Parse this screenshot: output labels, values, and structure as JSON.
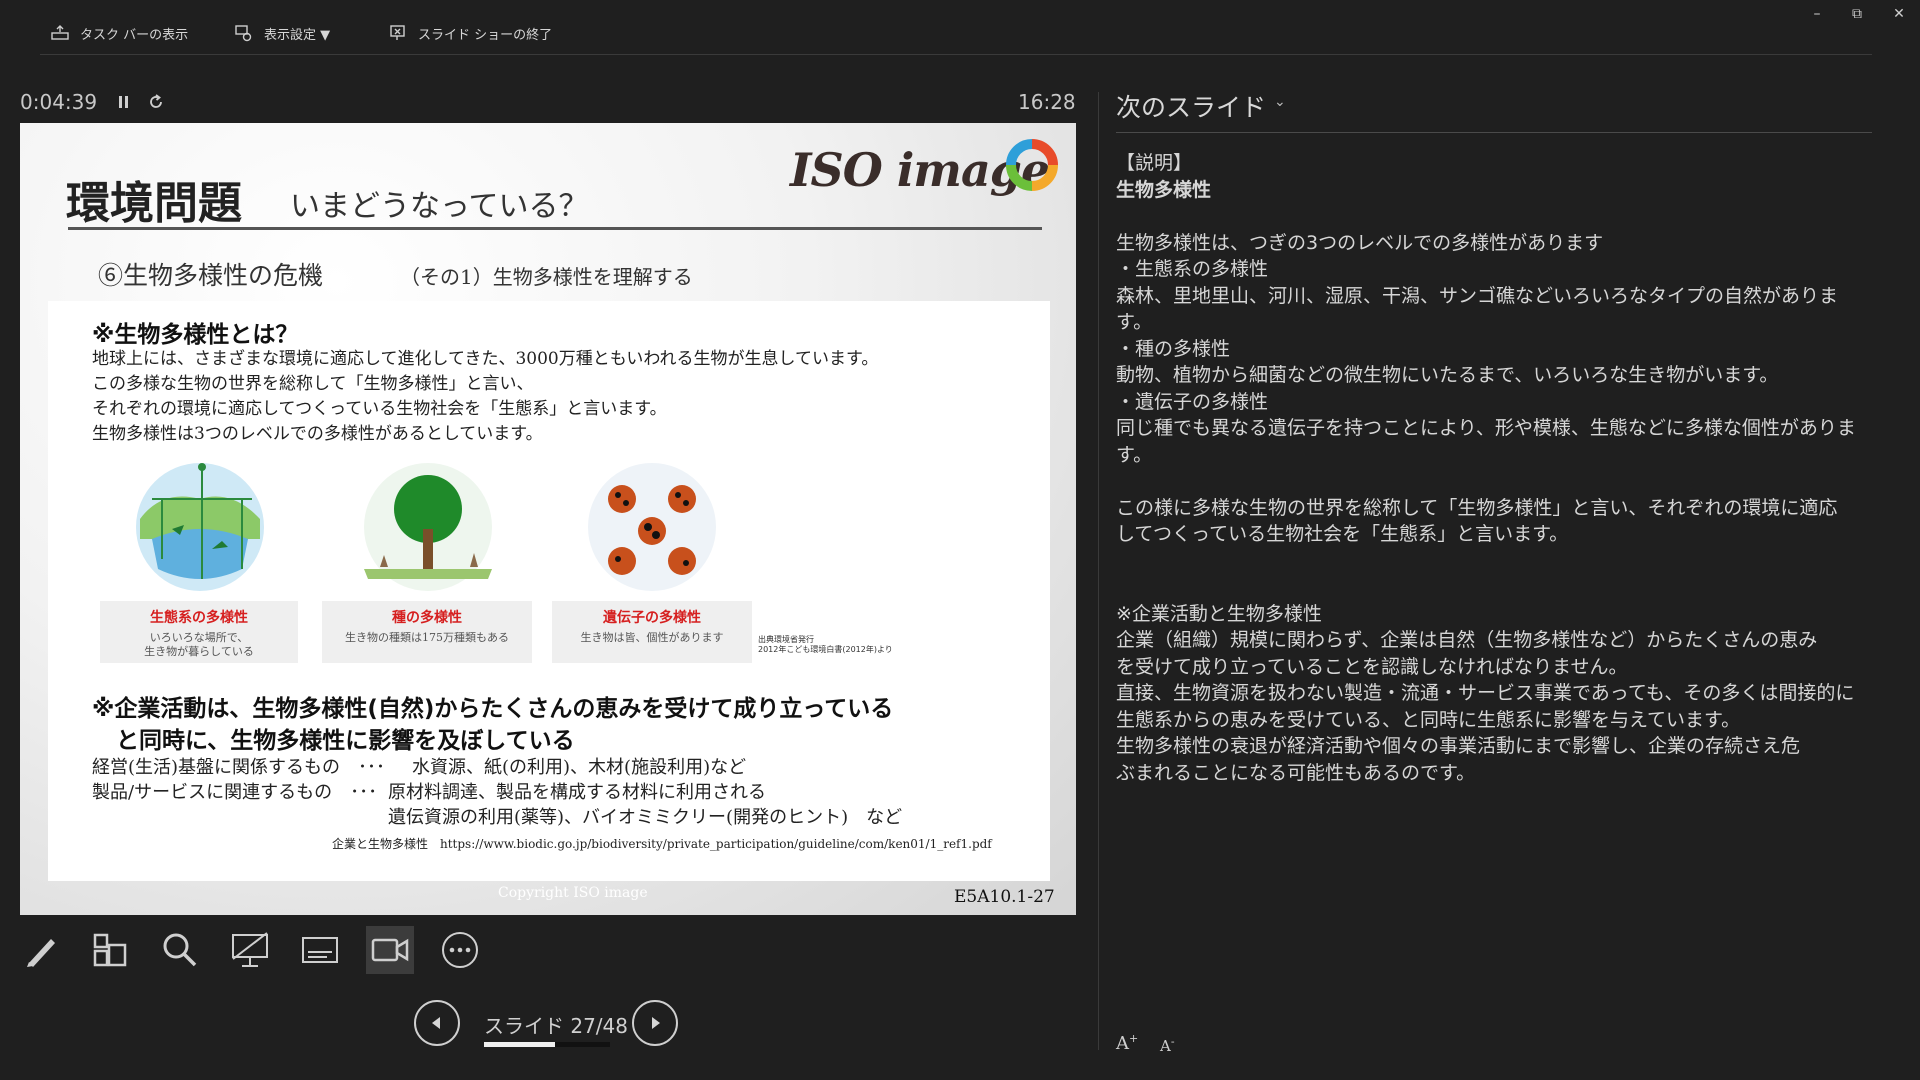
{
  "toolbar": {
    "taskbar_label": "タスク バーの表示",
    "display_settings_label": "表示設定 ▼",
    "end_show_label": "スライド ショーの終了"
  },
  "window": {
    "minimize": "–",
    "restore": "⧉",
    "close": "✕"
  },
  "presenter": {
    "elapsed": "0:04:39",
    "clock": "16:28",
    "slide_counter": "スライド 27/48",
    "progress_fraction": 0.5625
  },
  "slide": {
    "title": "環境問題",
    "subtitle": "いまどうなっている？",
    "section": "⑥生物多様性の危機",
    "section_sub": "（その1）生物多様性を理解する",
    "logo_text": "ISO image",
    "heading1": "※生物多様性とは？",
    "body": [
      "地球上には、さまざまな環境に適応して進化してきた、3000万種ともいわれる生物が生息しています。",
      "この多様な生物の世界を総称して「生物多様性」と言い、",
      "それぞれの環境に適応してつくっている生物社会を「生態系」と言います。",
      "生物多様性は3つのレベルでの多様性があるとしています。"
    ],
    "captions": [
      {
        "title": "生態系の多様性",
        "text1": "いろいろな場所で、",
        "text2": "生き物が暮らしている"
      },
      {
        "title": "種の多様性",
        "text1": "生き物の種類は175万種類もある",
        "text2": ""
      },
      {
        "title": "遺伝子の多様性",
        "text1": "生き物は皆、個性があります",
        "text2": ""
      }
    ],
    "source_note_1": "出典環境省発行",
    "source_note_2": "2012年こども環境白書(2012年)より",
    "heading2_line1": "※企業活動は、生物多様性(自然)からたくさんの恵みを受けて成り立っている",
    "heading2_line2": "と同時に、生物多様性に影響を及ぼしている",
    "list": [
      {
        "key": "経営(生活)基盤に関係するもの　･･･",
        "value": "水資源、紙(の利用)、木材(施設利用)など"
      },
      {
        "key": "製品/サービスに関連するもの　･･･",
        "value": "原材料調達、製品を構成する材料に利用される"
      },
      {
        "key": "",
        "value": "遺伝資源の利用(薬等)、バイオミミクリー(開発のヒント)　など"
      }
    ],
    "url_line": "企業と生物多様性　https://www.biodic.go.jp/biodiversity/private_participation/guideline/com/ken01/1_ref1.pdf",
    "copyright": "Copyright ISO image",
    "code": "E5A10.1-27"
  },
  "notes": {
    "header": "次のスライド",
    "lines": [
      "【説明】",
      "生物多様性",
      "",
      "生物多様性は、つぎの3つのレベルでの多様性があります",
      "・生態系の多様性",
      "森林、里地里山、河川、湿原、干潟、サンゴ礁などいろいろなタイプの自然があります。",
      "・種の多様性",
      "動物、植物から細菌などの微生物にいたるまで、いろいろな生き物がいます。",
      "・遺伝子の多様性",
      "同じ種でも異なる遺伝子を持つことにより、形や模様、生態などに多様な個性がありま",
      "す。",
      "",
      "この様に多様な生物の世界を総称して「生物多様性」と言い、それぞれの環境に適応",
      "してつくっている生物社会を「生態系」と言います。",
      "",
      "",
      "※企業活動と生物多様性",
      "企業（組織）規模に関わらず、企業は自然（生物多様性など）からたくさんの恵み",
      "を受けて成り立っていることを認識しなければなりません。",
      "直接、生物資源を扱わない製造・流通・サービス事業であっても、その多くは間接的に",
      "生態系からの恵みを受けている、と同時に生態系に影響を与えています。",
      "生物多様性の衰退が経済活動や個々の事業活動にまで影響し、企業の存続さえ危",
      "ぶまれることになる可能性もあるのです。"
    ],
    "increase_font": "A",
    "decrease_font": "A"
  },
  "colors": {
    "background": "#1f1f1f",
    "caption_red": "#d62020",
    "slide_panel": "#ffffff"
  },
  "icons": [
    "taskbar-icon",
    "display-settings-icon",
    "end-show-icon",
    "pause-icon",
    "reset-icon",
    "pen-icon",
    "all-slides-icon",
    "zoom-icon",
    "screen-icon",
    "subtitles-icon",
    "camera-icon",
    "more-icon",
    "prev-icon",
    "next-icon"
  ]
}
